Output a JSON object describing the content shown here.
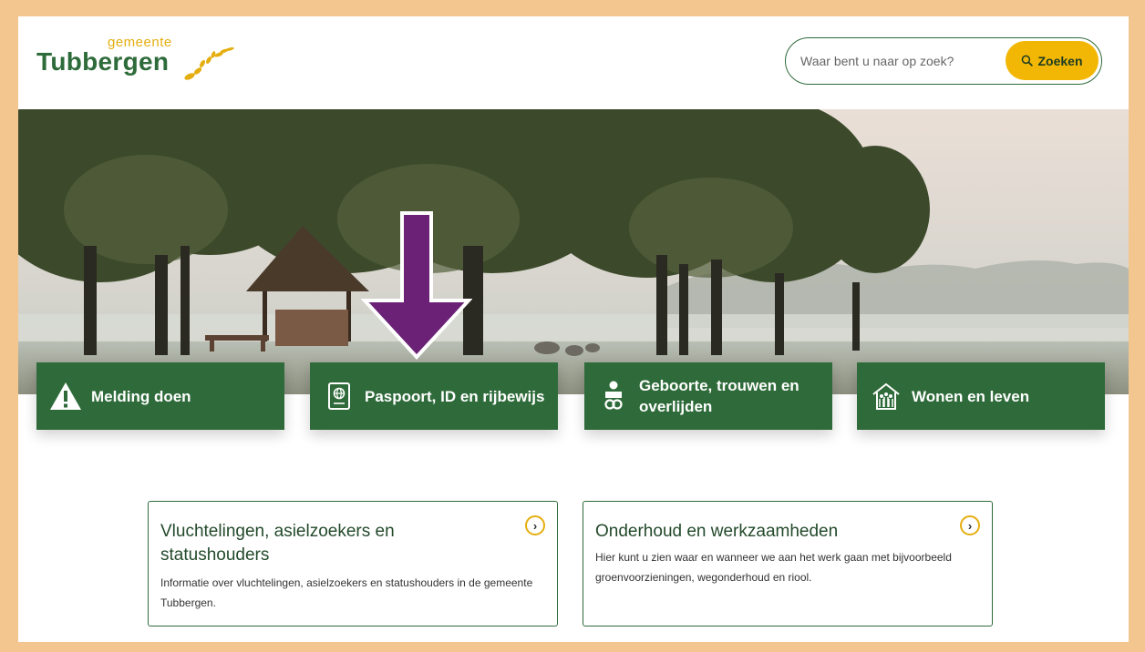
{
  "header": {
    "logo_small": "gemeente",
    "logo_big": "Tubbergen",
    "search_placeholder": "Waar bent u naar op zoek?",
    "search_button": "Zoeken"
  },
  "tiles": [
    {
      "label": "Melding doen",
      "icon": "warning-icon"
    },
    {
      "label": "Paspoort, ID en rijbewijs",
      "icon": "passport-icon"
    },
    {
      "label": "Geboorte, trouwen en overlijden",
      "icon": "person-rings-icon"
    },
    {
      "label": "Wonen en leven",
      "icon": "house-family-icon"
    }
  ],
  "cards": [
    {
      "title": "Vluchtelingen, asielzoekers en statushouders",
      "description": "Informatie over vluchtelingen, asielzoekers en statushouders in de gemeente Tubbergen."
    },
    {
      "title": "Onderhoud en werkzaamheden",
      "description": "Hier kunt u zien waar en wanneer we aan het werk gaan met bijvoorbeeld groenvoorzieningen, wegonderhoud en riool."
    }
  ],
  "colors": {
    "frame": "#f3c58f",
    "brand_green": "#2f6b3a",
    "brand_yellow": "#f2b705",
    "annotation_arrow": "#6b2176"
  }
}
